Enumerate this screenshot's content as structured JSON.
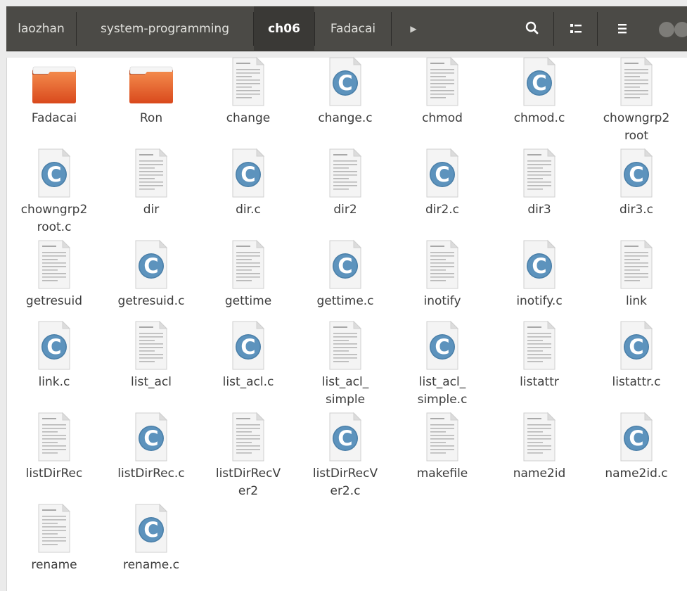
{
  "pathbar": {
    "crumbs": [
      "laozhan",
      "system-programming",
      "ch06",
      "Fadacai"
    ],
    "active": "ch06"
  },
  "toolbar": {
    "search_icon": "search-icon",
    "view_icon": "view-toggle-icon",
    "menu_icon": "hamburger-menu-icon"
  },
  "files": [
    {
      "name": "Fadacai",
      "type": "folder"
    },
    {
      "name": "Ron",
      "type": "folder"
    },
    {
      "name": "change",
      "type": "text"
    },
    {
      "name": "change.c",
      "type": "c"
    },
    {
      "name": "chmod",
      "type": "text"
    },
    {
      "name": "chmod.c",
      "type": "c"
    },
    {
      "name": "chowngrp2\nroot",
      "type": "text"
    },
    {
      "name": "chowngrp2\nroot.c",
      "type": "c"
    },
    {
      "name": "dir",
      "type": "text"
    },
    {
      "name": "dir.c",
      "type": "c"
    },
    {
      "name": "dir2",
      "type": "text"
    },
    {
      "name": "dir2.c",
      "type": "c"
    },
    {
      "name": "dir3",
      "type": "text"
    },
    {
      "name": "dir3.c",
      "type": "c"
    },
    {
      "name": "getresuid",
      "type": "text"
    },
    {
      "name": "getresuid.c",
      "type": "c"
    },
    {
      "name": "gettime",
      "type": "text"
    },
    {
      "name": "gettime.c",
      "type": "c"
    },
    {
      "name": "inotify",
      "type": "text"
    },
    {
      "name": "inotify.c",
      "type": "c"
    },
    {
      "name": "link",
      "type": "text"
    },
    {
      "name": "link.c",
      "type": "c"
    },
    {
      "name": "list_acl",
      "type": "text"
    },
    {
      "name": "list_acl.c",
      "type": "c"
    },
    {
      "name": "list_acl_\nsimple",
      "type": "text"
    },
    {
      "name": "list_acl_\nsimple.c",
      "type": "c"
    },
    {
      "name": "listattr",
      "type": "text"
    },
    {
      "name": "listattr.c",
      "type": "c"
    },
    {
      "name": "listDirRec",
      "type": "text"
    },
    {
      "name": "listDirRec.c",
      "type": "c"
    },
    {
      "name": "listDirRecV\ner2",
      "type": "text"
    },
    {
      "name": "listDirRecV\ner2.c",
      "type": "c"
    },
    {
      "name": "makefile",
      "type": "text"
    },
    {
      "name": "name2id",
      "type": "text"
    },
    {
      "name": "name2id.c",
      "type": "c"
    },
    {
      "name": "rename",
      "type": "text"
    },
    {
      "name": "rename.c",
      "type": "c"
    }
  ],
  "colors": {
    "pathbar_bg": "#4b4a46",
    "active_crumb_bg": "#3a3936",
    "folder_orange": "#e95420",
    "c_icon_blue": "#4a7fa8"
  }
}
